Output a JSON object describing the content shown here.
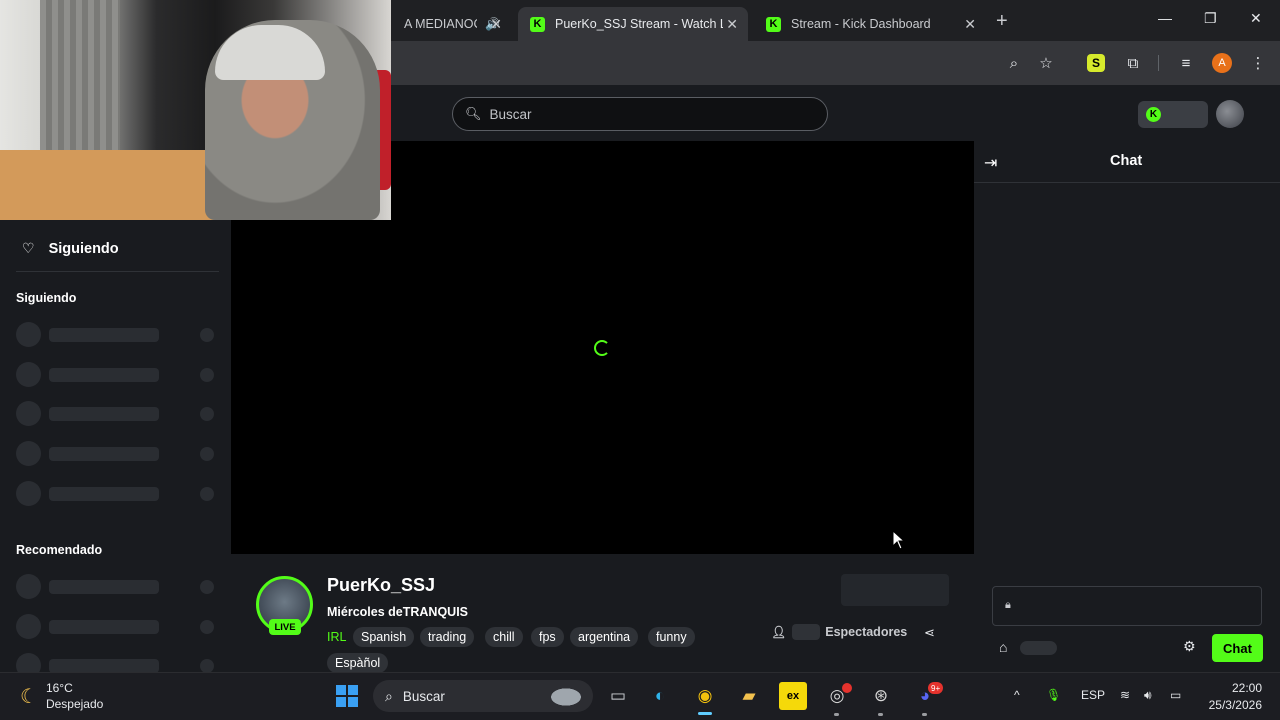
{
  "browser": {
    "tabs": [
      {
        "title": "A MEDIANOCHE",
        "active": false
      },
      {
        "title": "PuerKo_SSJ Stream - Watch Live",
        "active": true
      },
      {
        "title": "Stream - Kick Dashboard",
        "active": false
      }
    ],
    "profile_initial": "A",
    "extension_letter": "S"
  },
  "header": {
    "search_placeholder": "Buscar"
  },
  "sidebar": {
    "following_label": "Siguiendo",
    "section_following": "Siguiendo",
    "section_recommended": "Recomendado"
  },
  "stream": {
    "channel_name": "PuerKo_SSJ",
    "title": "Miércoles deTRANQUIS",
    "category": "IRL",
    "live_label": "LIVE",
    "tags": [
      "Spanish",
      "trading",
      "chill",
      "fps",
      "argentina",
      "funny",
      "Espàñol"
    ],
    "viewers_label": "Espectadores"
  },
  "chat": {
    "title": "Chat",
    "send_label": "Chat"
  },
  "taskbar": {
    "weather_temp": "16°C",
    "weather_desc": "Despejado",
    "search_label": "Buscar",
    "discord_badge": "9+",
    "language": "ESP",
    "time": "22:00",
    "date": "25/3/2026"
  },
  "colors": {
    "kick_green": "#53fc18",
    "background": "#191b1f",
    "player": "#000000"
  }
}
